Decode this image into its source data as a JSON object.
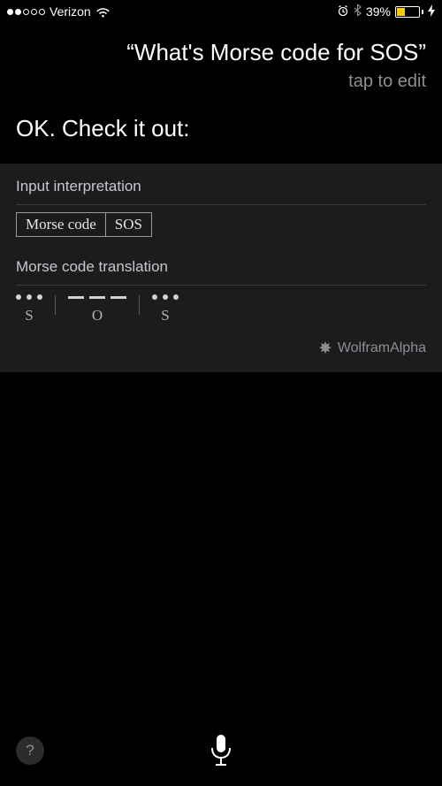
{
  "status_bar": {
    "signal_strength": 2,
    "carrier": "Verizon",
    "battery_percent": "39%"
  },
  "query": {
    "text": "“What's Morse code for SOS”",
    "edit_hint": "tap to edit"
  },
  "response": {
    "heading": "OK. Check it out:"
  },
  "card": {
    "input_section_label": "Input interpretation",
    "input_cells": [
      "Morse code",
      "SOS"
    ],
    "translation_section_label": "Morse code translation",
    "translation": [
      {
        "char": "S",
        "pattern": "..."
      },
      {
        "char": "O",
        "pattern": "---"
      },
      {
        "char": "S",
        "pattern": "..."
      }
    ],
    "attribution": "WolframAlpha"
  },
  "bottom": {
    "help_label": "?"
  }
}
